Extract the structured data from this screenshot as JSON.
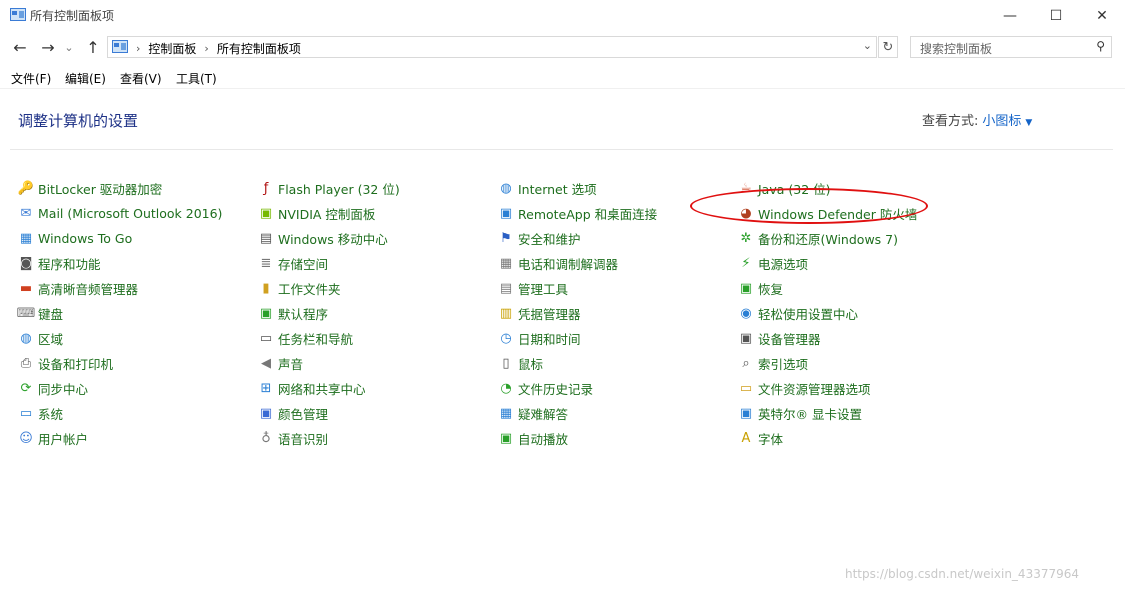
{
  "window": {
    "title": "所有控制面板项",
    "min_glyph": "—",
    "max_glyph": "☐",
    "close_glyph": "✕"
  },
  "nav": {
    "back": "←",
    "forward": "→",
    "recent": "⌄",
    "up": "↑",
    "breadcrumb": [
      "控制面板",
      "所有控制面板项"
    ],
    "search_placeholder": "搜索控制面板"
  },
  "menu": [
    "文件(F)",
    "编辑(E)",
    "查看(V)",
    "工具(T)"
  ],
  "heading": "调整计算机的设置",
  "view_by": {
    "label": "查看方式:",
    "value": "小图标"
  },
  "columns": [
    [
      {
        "label": "BitLocker 驱动器加密",
        "icon": "bitlocker-icon",
        "glyph": "🔑",
        "color": "#c8a000"
      },
      {
        "label": "Mail (Microsoft Outlook 2016)",
        "icon": "mail-icon",
        "glyph": "✉",
        "color": "#3a7bd5"
      },
      {
        "label": "Windows To Go",
        "icon": "windows-to-go-icon",
        "glyph": "▦",
        "color": "#2a7fd4"
      },
      {
        "label": "程序和功能",
        "icon": "programs-icon",
        "glyph": "◙",
        "color": "#555555"
      },
      {
        "label": "高清晰音频管理器",
        "icon": "audio-manager-icon",
        "glyph": "▬",
        "color": "#d04020"
      },
      {
        "label": "键盘",
        "icon": "keyboard-icon",
        "glyph": "⌨",
        "color": "#777777"
      },
      {
        "label": "区域",
        "icon": "region-icon",
        "glyph": "◍",
        "color": "#2a7fd4"
      },
      {
        "label": "设备和打印机",
        "icon": "printer-icon",
        "glyph": "⎙",
        "color": "#555555"
      },
      {
        "label": "同步中心",
        "icon": "sync-icon",
        "glyph": "⟳",
        "color": "#2aa02a"
      },
      {
        "label": "系统",
        "icon": "system-icon",
        "glyph": "▭",
        "color": "#2a7fd4"
      },
      {
        "label": "用户帐户",
        "icon": "user-accounts-icon",
        "glyph": "☺",
        "color": "#3a7bd5"
      }
    ],
    [
      {
        "label": "Flash Player (32 位)",
        "icon": "flash-icon",
        "glyph": "ƒ",
        "color": "#b01010"
      },
      {
        "label": "NVIDIA 控制面板",
        "icon": "nvidia-icon",
        "glyph": "▣",
        "color": "#76b900"
      },
      {
        "label": "Windows 移动中心",
        "icon": "mobility-center-icon",
        "glyph": "▤",
        "color": "#555555"
      },
      {
        "label": "存储空间",
        "icon": "storage-icon",
        "glyph": "≣",
        "color": "#777777"
      },
      {
        "label": "工作文件夹",
        "icon": "work-folders-icon",
        "glyph": "▮",
        "color": "#d0a020"
      },
      {
        "label": "默认程序",
        "icon": "default-programs-icon",
        "glyph": "▣",
        "color": "#2aa02a"
      },
      {
        "label": "任务栏和导航",
        "icon": "taskbar-icon",
        "glyph": "▭",
        "color": "#555555"
      },
      {
        "label": "声音",
        "icon": "sound-icon",
        "glyph": "◀",
        "color": "#777777"
      },
      {
        "label": "网络和共享中心",
        "icon": "network-icon",
        "glyph": "⊞",
        "color": "#2a7fd4"
      },
      {
        "label": "颜色管理",
        "icon": "color-management-icon",
        "glyph": "▣",
        "color": "#3a6ad4"
      },
      {
        "label": "语音识别",
        "icon": "speech-icon",
        "glyph": "♁",
        "color": "#777777"
      }
    ],
    [
      {
        "label": "Internet 选项",
        "icon": "internet-options-icon",
        "glyph": "◍",
        "color": "#2a7fd4"
      },
      {
        "label": "RemoteApp 和桌面连接",
        "icon": "remoteapp-icon",
        "glyph": "▣",
        "color": "#2a7fd4"
      },
      {
        "label": "安全和维护",
        "icon": "security-flag-icon",
        "glyph": "⚑",
        "color": "#2a5fc4"
      },
      {
        "label": "电话和调制解调器",
        "icon": "phone-modem-icon",
        "glyph": "▦",
        "color": "#777777"
      },
      {
        "label": "管理工具",
        "icon": "admin-tools-icon",
        "glyph": "▤",
        "color": "#777777"
      },
      {
        "label": "凭据管理器",
        "icon": "credential-icon",
        "glyph": "▥",
        "color": "#c8a000"
      },
      {
        "label": "日期和时间",
        "icon": "date-time-icon",
        "glyph": "◷",
        "color": "#2a7fd4"
      },
      {
        "label": "鼠标",
        "icon": "mouse-icon",
        "glyph": "▯",
        "color": "#555555"
      },
      {
        "label": "文件历史记录",
        "icon": "file-history-icon",
        "glyph": "◔",
        "color": "#2aa02a"
      },
      {
        "label": "疑难解答",
        "icon": "troubleshoot-icon",
        "glyph": "▦",
        "color": "#2a7fd4"
      },
      {
        "label": "自动播放",
        "icon": "autoplay-icon",
        "glyph": "▣",
        "color": "#2aa02a"
      }
    ],
    [
      {
        "label": "Java (32 位)",
        "icon": "java-icon",
        "glyph": "☕",
        "color": "#d04020"
      },
      {
        "label": "Windows Defender 防火墙",
        "icon": "firewall-icon",
        "glyph": "◕",
        "color": "#b04020"
      },
      {
        "label": "备份和还原(Windows 7)",
        "icon": "backup-icon",
        "glyph": "✲",
        "color": "#2aa02a"
      },
      {
        "label": "电源选项",
        "icon": "power-icon",
        "glyph": "⚡",
        "color": "#2aa02a"
      },
      {
        "label": "恢复",
        "icon": "recovery-icon",
        "glyph": "▣",
        "color": "#2aa02a"
      },
      {
        "label": "轻松使用设置中心",
        "icon": "ease-of-access-icon",
        "glyph": "◉",
        "color": "#2a7fd4"
      },
      {
        "label": "设备管理器",
        "icon": "device-manager-icon",
        "glyph": "▣",
        "color": "#555555"
      },
      {
        "label": "索引选项",
        "icon": "indexing-icon",
        "glyph": "⌕",
        "color": "#555555"
      },
      {
        "label": "文件资源管理器选项",
        "icon": "explorer-options-icon",
        "glyph": "▭",
        "color": "#d0a020"
      },
      {
        "label": "英特尔® 显卡设置",
        "icon": "intel-graphics-icon",
        "glyph": "▣",
        "color": "#2a7fd4"
      },
      {
        "label": "字体",
        "icon": "fonts-icon",
        "glyph": "A",
        "color": "#c8a000"
      }
    ]
  ],
  "watermark": "https://blog.csdn.net/weixin_43377964"
}
